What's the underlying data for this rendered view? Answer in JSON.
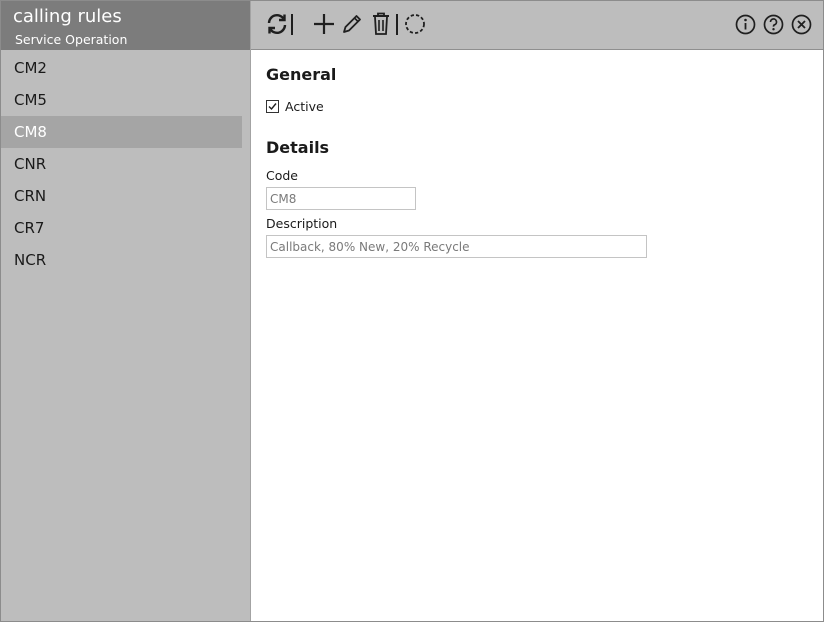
{
  "app": {
    "title": "calling rules",
    "subtitle": "Service Operation"
  },
  "rules": [
    {
      "label": "CM2",
      "selected": false
    },
    {
      "label": "CM5",
      "selected": false
    },
    {
      "label": "CM8",
      "selected": true
    },
    {
      "label": "CNR",
      "selected": false
    },
    {
      "label": "CRN",
      "selected": false
    },
    {
      "label": "CR7",
      "selected": false
    },
    {
      "label": "NCR",
      "selected": false
    }
  ],
  "toolbar": {
    "left_icons": [
      "refresh-icon",
      "add-icon",
      "edit-icon",
      "delete-icon",
      "discard-icon"
    ],
    "right_icons": [
      "info-icon",
      "help-icon",
      "close-icon"
    ]
  },
  "general": {
    "heading": "General",
    "active_label": "Active",
    "active_checked": true
  },
  "details": {
    "heading": "Details",
    "code_label": "Code",
    "code_value": "CM8",
    "description_label": "Description",
    "description_value": "Callback, 80% New, 20% Recycle"
  },
  "colors": {
    "panel_bg": "#bdbdbd",
    "header_bg": "#7c7c7c",
    "selected_bg": "#a5a5a5"
  }
}
